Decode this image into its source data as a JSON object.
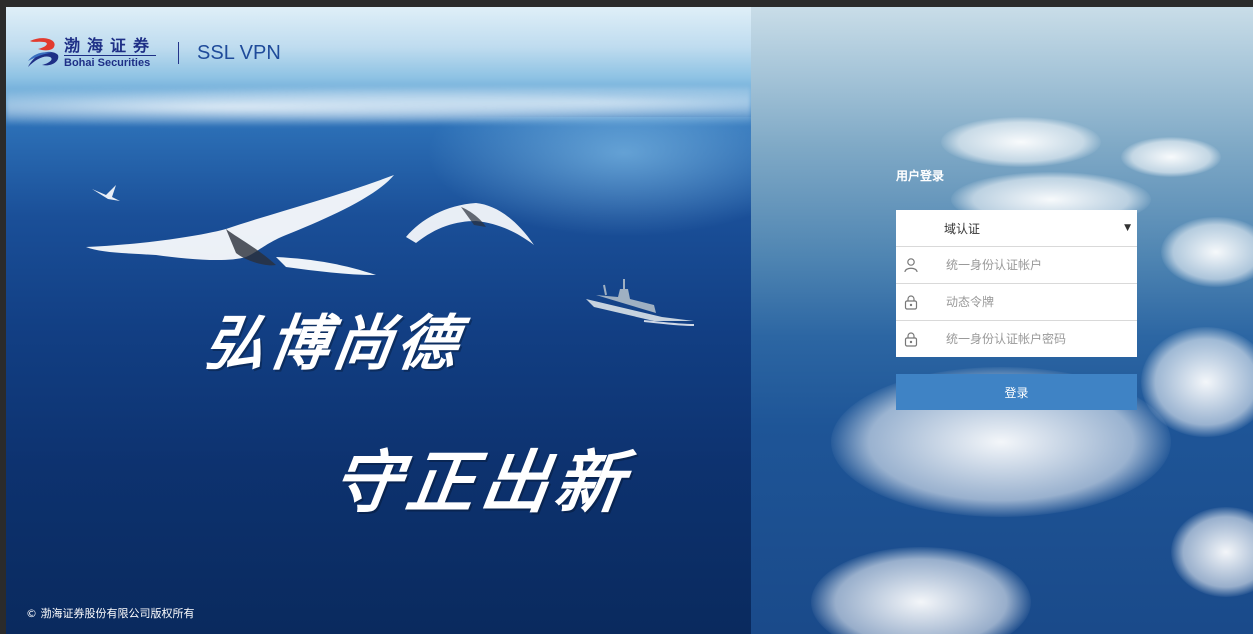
{
  "logo": {
    "cn": "渤海证券",
    "en": "Bohai Securities",
    "product": "SSL VPN"
  },
  "hero": {
    "slogan_line1": "弘博尚德",
    "slogan_line2": "守正出新"
  },
  "copyright": "© 渤海证券股份有限公司版权所有",
  "login": {
    "title": "用户登录",
    "auth_select": "域认证",
    "username_placeholder": "统一身份认证帐户",
    "token_placeholder": "动态令牌",
    "password_placeholder": "统一身份认证帐户密码",
    "submit_label": "登录"
  },
  "colors": {
    "brand_blue": "#1e2f86",
    "button": "#3f83c5"
  }
}
